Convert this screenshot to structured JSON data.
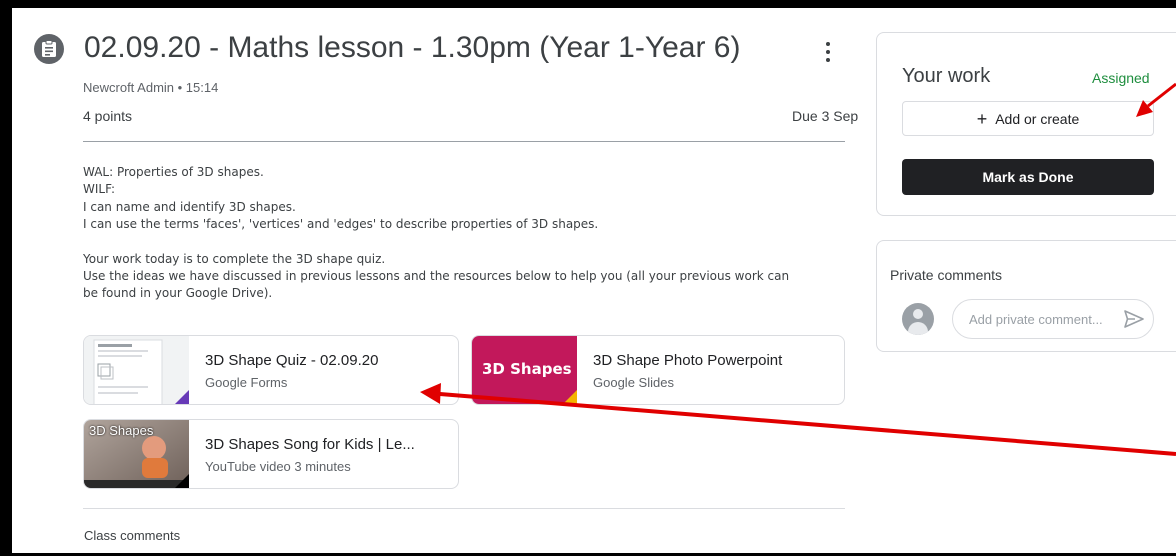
{
  "assignment": {
    "title": "02.09.20 - Maths lesson - 1.30pm (Year 1-Year 6)",
    "author_time": "Newcroft Admin • 15:14",
    "points": "4 points",
    "due": "Due 3 Sep",
    "description": {
      "wal": "WAL: Properties of 3D shapes.",
      "wilf": "WILF:",
      "goal1": "I can name and identify 3D shapes.",
      "goal2": "I can use the terms 'faces', 'vertices' and 'edges' to describe properties of 3D shapes.",
      "task": "Your work today is to complete the 3D shape quiz.",
      "help1": "Use the ideas we have discussed in previous lessons and the resources below to help you (all your previous work can",
      "help2": "be found in your Google Drive)."
    },
    "attachments": [
      {
        "title": "3D Shape Quiz - 02.09.20",
        "type": "Google Forms",
        "corner_color": "#673ab7"
      },
      {
        "title": "3D Shape Photo Powerpoint",
        "type": "Google Slides",
        "thumb_text": "3D Shapes",
        "thumb_color": "#c2185b",
        "corner_color": "#f4b400"
      },
      {
        "title": "3D Shapes Song for Kids | Le...",
        "type": "YouTube video  3 minutes",
        "thumb_text": "3D Shapes",
        "corner_color": "#000000"
      }
    ],
    "class_comments_label": "Class comments"
  },
  "your_work": {
    "title": "Your work",
    "status": "Assigned",
    "status_color": "#1e8e3e",
    "add_label": "Add or create",
    "mark_done_label": "Mark as Done"
  },
  "private_comments": {
    "title": "Private comments",
    "placeholder": "Add private comment..."
  },
  "annotation_color": "#e00000"
}
